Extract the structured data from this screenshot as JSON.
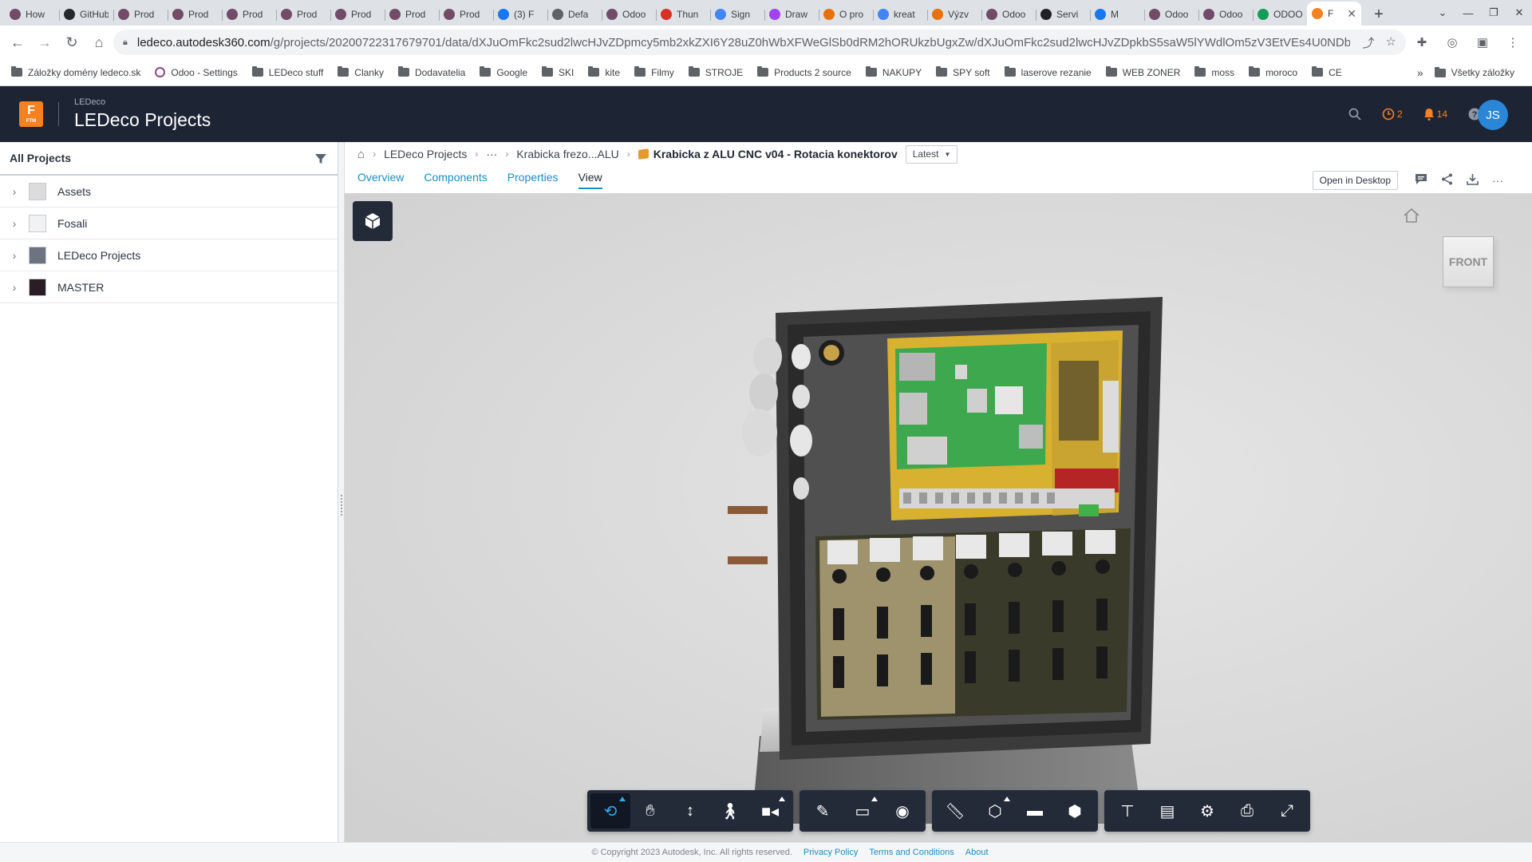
{
  "browser": {
    "tabs": [
      {
        "title": "How",
        "icon": "odoo-icon",
        "color": "#714b67"
      },
      {
        "title": "GitHub",
        "icon": "github-icon",
        "color": "#24292f"
      },
      {
        "title": "Prod",
        "icon": "odoo-icon",
        "color": "#714b67"
      },
      {
        "title": "Prod",
        "icon": "odoo-icon",
        "color": "#714b67"
      },
      {
        "title": "Prod",
        "icon": "odoo-icon",
        "color": "#714b67"
      },
      {
        "title": "Prod",
        "icon": "odoo-icon",
        "color": "#714b67"
      },
      {
        "title": "Prod",
        "icon": "odoo-icon",
        "color": "#714b67"
      },
      {
        "title": "Prod",
        "icon": "odoo-icon",
        "color": "#714b67"
      },
      {
        "title": "Prod",
        "icon": "odoo-icon",
        "color": "#714b67"
      },
      {
        "title": "(3) F",
        "icon": "facebook-icon",
        "color": "#1877f2"
      },
      {
        "title": "Defa",
        "icon": "globe-icon",
        "color": "#5f6368"
      },
      {
        "title": "Odoo",
        "icon": "odoo-icon",
        "color": "#714b67"
      },
      {
        "title": "Thun",
        "icon": "thunder-icon",
        "color": "#d93025"
      },
      {
        "title": "Sign",
        "icon": "google-icon",
        "color": "#4285f4"
      },
      {
        "title": "Draw",
        "icon": "draw-icon",
        "color": "#a142f4"
      },
      {
        "title": "O pro",
        "icon": "chrome-icon",
        "color": "#e8710a"
      },
      {
        "title": "kreat",
        "icon": "google-icon",
        "color": "#4285f4"
      },
      {
        "title": "Výzv",
        "icon": "chrome-icon",
        "color": "#e8710a"
      },
      {
        "title": "Odoo",
        "icon": "odoo-icon",
        "color": "#714b67"
      },
      {
        "title": "Servi",
        "icon": "gmail-icon",
        "color": "#202124"
      },
      {
        "title": "M",
        "icon": "facebook-icon",
        "color": "#1877f2"
      },
      {
        "title": "Odoo",
        "icon": "odoo-icon",
        "color": "#714b67"
      },
      {
        "title": "Odoo",
        "icon": "odoo-icon",
        "color": "#714b67"
      },
      {
        "title": "ODOO",
        "icon": "sheets-icon",
        "color": "#0f9d58"
      },
      {
        "title": "F",
        "icon": "fusion-icon",
        "color": "#f58220",
        "active": true
      }
    ],
    "new_tab": "+",
    "url_domain": "ledeco.autodesk360.com",
    "url_path": "/g/projects/20200722317679701/data/dXJuOmFkc2sud2lwcHJvZDpmcy5mb2xkZXI6Y28uZ0hWbXFWeGlSb0dRM2hORUkzbUgxZw/dXJuOmFkc2sud2lwcHJvZDpkbS5saW5lYWdlOm5zV3EtVEs4U0NDbGJ5alpkRGDcl...",
    "bookmarks": [
      "Záložky domény ledeco.sk",
      "Odoo - Settings",
      "LEDeco stuff",
      "Clanky",
      "Dodavatelia",
      "Google",
      "SKI",
      "kite",
      "Filmy",
      "STROJE",
      "Products 2 source",
      "NAKUPY",
      "SPY soft",
      "laserove rezanie",
      "WEB ZONER",
      "moss",
      "moroco",
      "CE"
    ],
    "bookmarks_more": "»",
    "all_bookmarks": "Všetky záložky"
  },
  "header": {
    "logo_letter": "F",
    "logo_sub": "FTM",
    "hub_name": "LEDeco",
    "title": "LEDeco Projects",
    "jobs_count": "2",
    "notifications_count": "14",
    "avatar_initials": "JS",
    "brand_color": "#f58220"
  },
  "left_panel": {
    "heading": "All Projects",
    "items": [
      {
        "label": "Assets"
      },
      {
        "label": "Fosali"
      },
      {
        "label": "LEDeco Projects"
      },
      {
        "label": "MASTER"
      }
    ]
  },
  "breadcrumb": {
    "project": "LEDeco Projects",
    "ellipsis": "···",
    "folder": "Krabicka frezo...ALU",
    "current": "Krabicka z ALU CNC v04 - Rotacia konektorov",
    "version": "Latest"
  },
  "view_tabs": [
    "Overview",
    "Components",
    "Properties",
    "View"
  ],
  "actions": {
    "open_desktop": "Open in Desktop"
  },
  "viewer": {
    "viewcube_face": "FRONT",
    "accent_color": "#31a9e6"
  },
  "footer": {
    "copyright": "© Copyright 2023 Autodesk, Inc. All rights reserved.",
    "privacy": "Privacy Policy",
    "terms": "Terms and Conditions",
    "about": "About"
  }
}
